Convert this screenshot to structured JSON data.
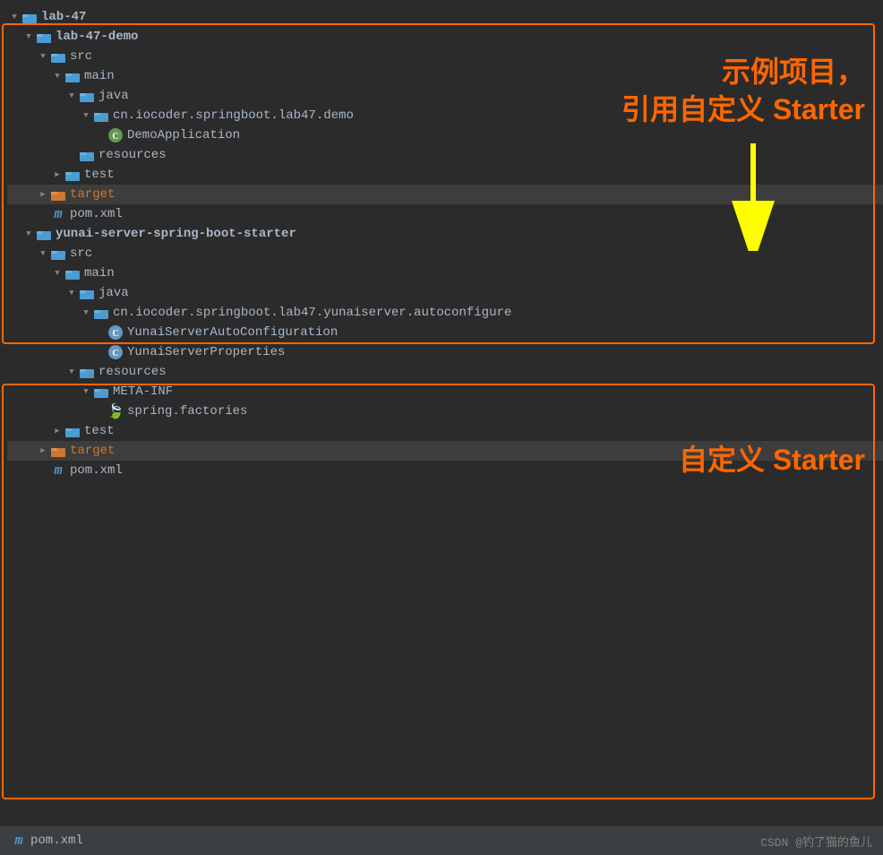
{
  "root": {
    "label": "lab-47",
    "folder_color": "blue"
  },
  "demo_box": {
    "annotation": "示例项目，\n引用自定义 Starter"
  },
  "starter_box": {
    "annotation": "自定义 Starter"
  },
  "bottom": {
    "pom_label": "pom.xml",
    "credit": "CSDN @钓了猫的鱼儿"
  },
  "tree": [
    {
      "id": "lab47",
      "indent": 0,
      "arrow": "down",
      "icon": "folder-blue",
      "label": "lab-47",
      "bold": true
    },
    {
      "id": "lab47demo",
      "indent": 1,
      "arrow": "down",
      "icon": "folder-blue",
      "label": "lab-47-demo",
      "bold": true
    },
    {
      "id": "src1",
      "indent": 2,
      "arrow": "down",
      "icon": "folder-blue",
      "label": "src"
    },
    {
      "id": "main1",
      "indent": 3,
      "arrow": "down",
      "icon": "folder-blue",
      "label": "main"
    },
    {
      "id": "java1",
      "indent": 4,
      "arrow": "down",
      "icon": "folder-blue",
      "label": "java"
    },
    {
      "id": "pkg1",
      "indent": 5,
      "arrow": "down",
      "icon": "folder-pkg",
      "label": "cn.iocoder.springboot.lab47.demo"
    },
    {
      "id": "demoapp",
      "indent": 6,
      "arrow": "none",
      "icon": "class-green",
      "label": "DemoApplication"
    },
    {
      "id": "res1",
      "indent": 4,
      "arrow": "none",
      "icon": "folder-res",
      "label": "resources"
    },
    {
      "id": "test1",
      "indent": 3,
      "arrow": "right",
      "icon": "folder-blue",
      "label": "test"
    },
    {
      "id": "target1",
      "indent": 2,
      "arrow": "right",
      "icon": "folder-orange",
      "label": "target",
      "orange": true,
      "highlighted": true
    },
    {
      "id": "pom1",
      "indent": 2,
      "arrow": "none",
      "icon": "m",
      "label": "pom.xml"
    },
    {
      "id": "starter",
      "indent": 1,
      "arrow": "down",
      "icon": "folder-blue",
      "label": "yunai-server-spring-boot-starter",
      "bold": true
    },
    {
      "id": "src2",
      "indent": 2,
      "arrow": "down",
      "icon": "folder-blue",
      "label": "src"
    },
    {
      "id": "main2",
      "indent": 3,
      "arrow": "down",
      "icon": "folder-blue",
      "label": "main"
    },
    {
      "id": "java2",
      "indent": 4,
      "arrow": "down",
      "icon": "folder-blue",
      "label": "java"
    },
    {
      "id": "pkg2",
      "indent": 5,
      "arrow": "down",
      "icon": "folder-pkg",
      "label": "cn.iocoder.springboot.lab47.yunaiserver.autoconfigure"
    },
    {
      "id": "class1",
      "indent": 6,
      "arrow": "none",
      "icon": "class-blue",
      "label": "YunaiServerAutoConfiguration"
    },
    {
      "id": "class2",
      "indent": 6,
      "arrow": "none",
      "icon": "class-blue",
      "label": "YunaiServerProperties"
    },
    {
      "id": "res2",
      "indent": 4,
      "arrow": "down",
      "icon": "folder-res",
      "label": "resources"
    },
    {
      "id": "metainf",
      "indent": 5,
      "arrow": "down",
      "icon": "folder-blue",
      "label": "META-INF"
    },
    {
      "id": "spring_factories",
      "indent": 6,
      "arrow": "none",
      "icon": "spring",
      "label": "spring.factories"
    },
    {
      "id": "test2",
      "indent": 3,
      "arrow": "right",
      "icon": "folder-blue",
      "label": "test"
    },
    {
      "id": "target2",
      "indent": 2,
      "arrow": "right",
      "icon": "folder-orange",
      "label": "target",
      "orange": true,
      "highlighted": true
    },
    {
      "id": "pom2",
      "indent": 2,
      "arrow": "none",
      "icon": "m",
      "label": "pom.xml"
    }
  ]
}
